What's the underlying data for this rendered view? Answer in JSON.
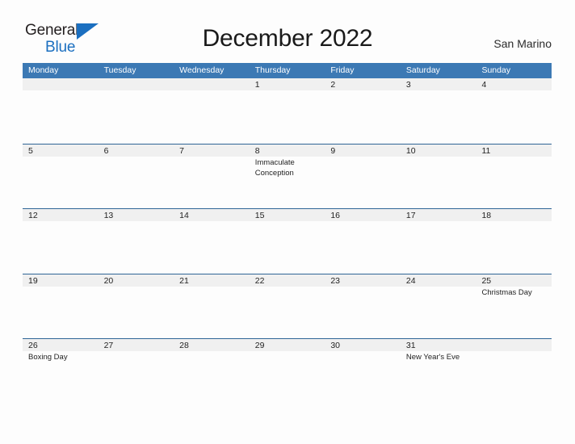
{
  "brand": {
    "name_part1": "General",
    "name_part2": "Blue",
    "flag_icon": "flag-triangle-icon",
    "color_text": "#231f20",
    "color_blue": "#1b6fc0"
  },
  "header": {
    "title": "December 2022",
    "location": "San Marino"
  },
  "calendar": {
    "accent_header_color": "#3c79b4",
    "row_divider_color": "#2f6596",
    "date_band_color": "#f0f0f0",
    "weekdays": [
      "Monday",
      "Tuesday",
      "Wednesday",
      "Thursday",
      "Friday",
      "Saturday",
      "Sunday"
    ],
    "weeks": [
      [
        {
          "date": "",
          "events": []
        },
        {
          "date": "",
          "events": []
        },
        {
          "date": "",
          "events": []
        },
        {
          "date": "1",
          "events": []
        },
        {
          "date": "2",
          "events": []
        },
        {
          "date": "3",
          "events": []
        },
        {
          "date": "4",
          "events": []
        }
      ],
      [
        {
          "date": "5",
          "events": []
        },
        {
          "date": "6",
          "events": []
        },
        {
          "date": "7",
          "events": []
        },
        {
          "date": "8",
          "events": [
            "Immaculate",
            "Conception"
          ]
        },
        {
          "date": "9",
          "events": []
        },
        {
          "date": "10",
          "events": []
        },
        {
          "date": "11",
          "events": []
        }
      ],
      [
        {
          "date": "12",
          "events": []
        },
        {
          "date": "13",
          "events": []
        },
        {
          "date": "14",
          "events": []
        },
        {
          "date": "15",
          "events": []
        },
        {
          "date": "16",
          "events": []
        },
        {
          "date": "17",
          "events": []
        },
        {
          "date": "18",
          "events": []
        }
      ],
      [
        {
          "date": "19",
          "events": []
        },
        {
          "date": "20",
          "events": []
        },
        {
          "date": "21",
          "events": []
        },
        {
          "date": "22",
          "events": []
        },
        {
          "date": "23",
          "events": []
        },
        {
          "date": "24",
          "events": []
        },
        {
          "date": "25",
          "events": [
            "Christmas Day"
          ]
        }
      ],
      [
        {
          "date": "26",
          "events": [
            "Boxing Day"
          ]
        },
        {
          "date": "27",
          "events": []
        },
        {
          "date": "28",
          "events": []
        },
        {
          "date": "29",
          "events": []
        },
        {
          "date": "30",
          "events": []
        },
        {
          "date": "31",
          "events": [
            "New Year's Eve"
          ]
        },
        {
          "date": "",
          "events": []
        }
      ]
    ]
  }
}
